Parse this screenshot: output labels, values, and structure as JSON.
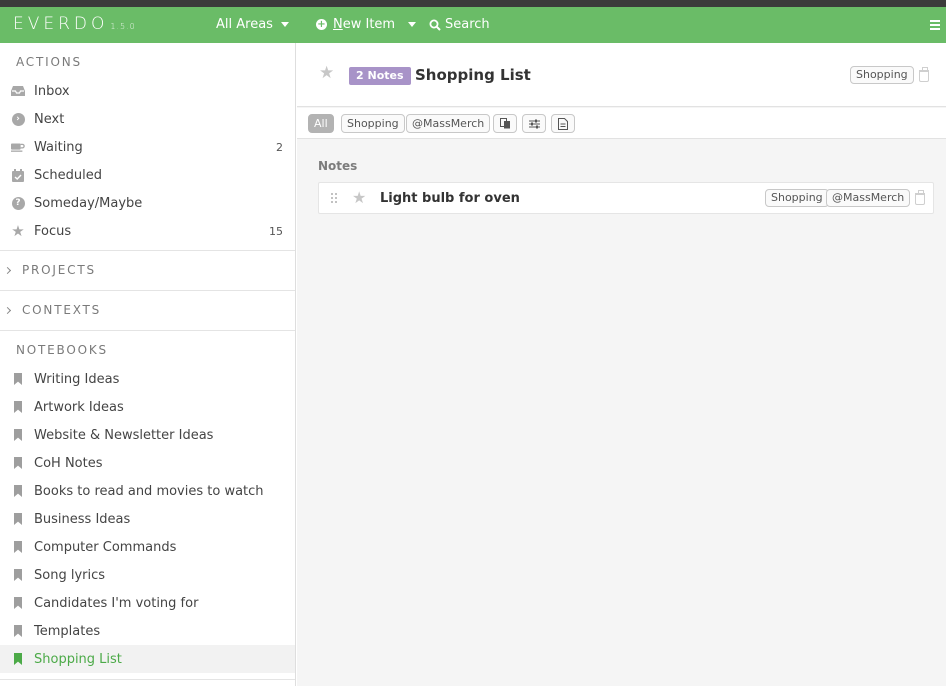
{
  "app": {
    "name": "EVERDO",
    "version": "1.5.0"
  },
  "topbar": {
    "areas_label": "All Areas",
    "new_item_prefix": "",
    "new_item_underlined": "N",
    "new_item_rest": "ew Item",
    "search_label": "Search"
  },
  "sidebar": {
    "actions_header": "ACTIONS",
    "actions": [
      {
        "label": "Inbox",
        "icon": "inbox-icon",
        "count": ""
      },
      {
        "label": "Next",
        "icon": "next-arrow-icon",
        "count": ""
      },
      {
        "label": "Waiting",
        "icon": "coffee-cup-icon",
        "count": "2"
      },
      {
        "label": "Scheduled",
        "icon": "calendar-check-icon",
        "count": ""
      },
      {
        "label": "Someday/Maybe",
        "icon": "question-circle-icon",
        "count": ""
      },
      {
        "label": "Focus",
        "icon": "star-icon",
        "count": "15"
      }
    ],
    "projects_header": "PROJECTS",
    "contexts_header": "CONTEXTS",
    "notebooks_header": "NOTEBOOKS",
    "notebooks": [
      {
        "label": "Writing Ideas"
      },
      {
        "label": "Artwork Ideas"
      },
      {
        "label": "Website & Newsletter Ideas"
      },
      {
        "label": "CoH Notes"
      },
      {
        "label": "Books to read and movies to watch"
      },
      {
        "label": "Business Ideas"
      },
      {
        "label": "Computer Commands"
      },
      {
        "label": "Song lyrics"
      },
      {
        "label": "Candidates I'm voting for"
      },
      {
        "label": "Templates"
      },
      {
        "label": "Shopping List",
        "active": true
      }
    ]
  },
  "main": {
    "notes_badge": "2 Notes",
    "title": "Shopping List",
    "header_tag": "Shopping",
    "filters": {
      "all": "All",
      "shopping": "Shopping",
      "massmerch": "@MassMerch"
    },
    "section_label": "Notes",
    "notes": [
      {
        "title": "Light bulb for oven",
        "tags": [
          "Shopping",
          "@MassMerch"
        ]
      }
    ]
  },
  "colors": {
    "brand_green": "#6abc67",
    "active_green": "#4caa48",
    "notes_badge_purple": "#a893c8"
  }
}
